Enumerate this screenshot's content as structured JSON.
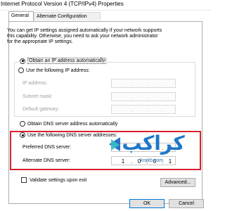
{
  "window": {
    "title": "Internet Protocol Version 4 (TCP/IPv4) Properties"
  },
  "tabs": [
    {
      "label": "General",
      "active": true
    },
    {
      "label": "Alternate Configuration",
      "active": false
    }
  ],
  "description": [
    "You can get IP settings assigned automatically if your network supports",
    "this capability. Otherwise, you need to ask your network administrator",
    "for the appropriate IP settings."
  ],
  "ip_section": {
    "auto_label": "Obtain an IP address automatically",
    "manual_label": "Use the following IP address:",
    "selected": "auto",
    "fields": [
      {
        "label": "IP address:",
        "value": ". . ."
      },
      {
        "label": "Subnet mask:",
        "value": ". . ."
      },
      {
        "label": "Default gateway:",
        "value": ". . ."
      }
    ]
  },
  "dns_section": {
    "auto_label": "Obtain DNS server address automatically",
    "manual_label": "Use the following DNS server addresses:",
    "selected": "manual",
    "preferred": {
      "label": "Preferred DNS server:",
      "octets": [
        "",
        "",
        "",
        ""
      ]
    },
    "alternate": {
      "label": "Alternate DNS server:",
      "octets": [
        "1",
        "0",
        "0",
        "1"
      ]
    }
  },
  "validate_label": "Validate settings upon exit",
  "buttons": {
    "advanced": "Advanced...",
    "ok": "OK",
    "cancel": "Cancel"
  },
  "watermark": {
    "text": "كراكب",
    "sub": "krakb.com"
  },
  "colors": {
    "highlight": "#d6212b",
    "accent": "#0078d7",
    "watermark": "#1e78c8"
  }
}
